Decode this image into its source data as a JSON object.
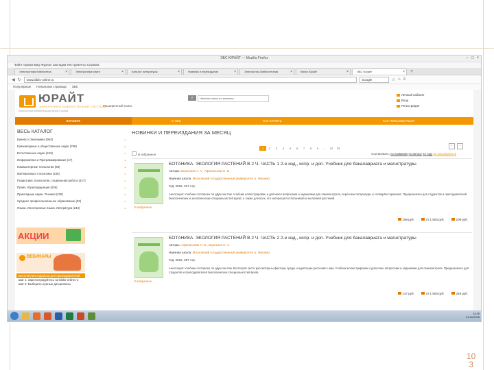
{
  "browser": {
    "window_title": "ЭБС ЮРАЙТ — Mozilla Firefox",
    "menu": "Файл  Правка  Вид  Журнал  Закладки  Инструменты  Справка",
    "tabs": [
      {
        "label": "Электронная библиотека",
        "active": false
      },
      {
        "label": "Электронные книги",
        "active": false
      },
      {
        "label": "Каталог литературы",
        "active": false
      },
      {
        "label": "Новинки и переиздания",
        "active": false
      },
      {
        "label": "Электронно-библиотечная",
        "active": false
      },
      {
        "label": "Книги Юрайт",
        "active": false
      },
      {
        "label": "ЭБС Юрайт",
        "active": true
      }
    ],
    "url": "www.biblio-online.ru",
    "search_placeholder": "Google",
    "bookmarks": [
      "Популярные",
      "Начальная страница",
      "ЭБС"
    ]
  },
  "site": {
    "logo_title": "ЮРАЙТ",
    "logo_subtitle": "ЭЛЕКТРОННО-БИБЛИОТЕЧНАЯ СИСТЕМА",
    "logo_tagline": "Электронная библиотека для вузов и ссузов",
    "search_placeholder": "Начните поиск по каталогу",
    "advanced_search": "Расширенный поиск",
    "top_links": [
      "Личный кабинет",
      "Вход",
      "Регистрация"
    ],
    "nav": [
      "КАТАЛОГ",
      "О ЭБС",
      "КАК КУПИТЬ",
      "КАК ПОЛЬЗОВАТЬСЯ"
    ]
  },
  "sidebar": {
    "title": "ВЕСЬ КАТАЛОГ",
    "categories": [
      "Бизнес и Экономика (963)",
      "Гуманитарные и общественные науки (799)",
      "Естественные науки (243)",
      "Информатика и Программирование (47)",
      "Компьютерные технологии (86)",
      "Математика и статистика (230)",
      "Педагогика, психология, социальная работа (427)",
      "Право. Юриспруденция (436)",
      "Прикладные науки. Техника (235)",
      "Среднее профессиональное образование (93)",
      "Языки. Иностранные языки. Литература (243)"
    ],
    "promo_sale": "АКЦИИ",
    "promo_webinars": "ВЕБИНАРЫ",
    "consult_head": "Бесплатная подписка для преподавателей",
    "consult_steps": [
      "Шаг 1: Зарегистрируйтесь на biblio-online.ru",
      "Шаг 2: Выберите нужные дисциплины"
    ]
  },
  "main": {
    "title": "НОВИНКИ И ПЕРЕИЗДАНИЯ ЗА МЕСЯЦ",
    "pages": [
      "1",
      "2",
      "3",
      "4",
      "5",
      "6",
      "7",
      "8",
      "9",
      "…",
      "22",
      "23"
    ],
    "current_page": "1",
    "to_cart": "В избранное",
    "sort_label": "Сортировать:",
    "sort_options": [
      "по названию",
      "по автору",
      "по году",
      "по популярности"
    ],
    "sort_selected": "по популярности",
    "books": [
      {
        "title": "БОТАНИКА. ЭКОЛОГИЯ РАСТЕНИЙ В 2 Ч. ЧАСТЬ 1 2-е изд., испр. и доп. Учебник для бакалавриата и магистратуры",
        "authors_label": "Авторы:",
        "authors": "Березина Н. А., Афанасьева Н. Б.",
        "publisher_label": "Научная школа:",
        "publisher": "Московский государственный университет (г. Москва)",
        "year": "Год: 2016, 317 стр.",
        "annotation": "Аннотация: Учебник составлен по двум частям. Учебник иллюстрирован и дополнен вопросами и заданиями для самоконтроля, перечнем литературы и словарём терминов. Предназначен для студентов и преподавателей биологических и экологических специальностей вузов, а также для всех, кто интересуется ботаникой и экологией растений.",
        "favorite": "В избранное",
        "prices": [
          "159 руб.",
          "от 1 500 руб.",
          "209 руб."
        ]
      },
      {
        "title": "БОТАНИКА. ЭКОЛОГИЯ РАСТЕНИЙ В 2 Ч. ЧАСТЬ 2 2-е изд., испр. и доп. Учебник для бакалавриата и магистратуры",
        "authors_label": "Авторы:",
        "authors": "Афанасьева Н. Б., Березина Н. А.",
        "publisher_label": "Научная школа:",
        "publisher": "Московский государственный университет (г. Москва)",
        "year": "Год: 2016, 287 стр.",
        "annotation": "Аннотация: Учебник составлен по двум частям. Во второй части рассмотрены факторы среды и адаптации растений к ним. Учебник иллюстрирован и дополнен вопросами и заданиями для самоконтроля. Предназначен для студентов и преподавателей биологических специальностей вузов.",
        "favorite": "В избранное",
        "prices": [
          "147 руб.",
          "от 1 500 руб.",
          "249 руб."
        ]
      }
    ]
  },
  "taskbar": {
    "clock": "14:45",
    "date": "13.10.2016"
  },
  "slide_number": "10\n3",
  "colors": {
    "brand_orange": "#f39800",
    "nav_dark": "#e07b00"
  }
}
